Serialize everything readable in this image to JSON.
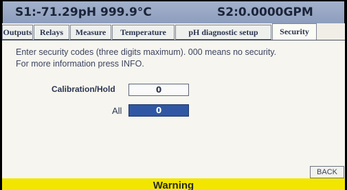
{
  "header": {
    "s1_reading": "S1:-71.29pH 999.9°C",
    "s2_reading": "S2:0.0000GPM"
  },
  "tabs": [
    {
      "label": "Outputs"
    },
    {
      "label": "Relays"
    },
    {
      "label": "Measure"
    },
    {
      "label": "Temperature"
    },
    {
      "label": "pH diagnostic setup"
    },
    {
      "label": "Security",
      "active": true
    }
  ],
  "panel": {
    "description_line1": "Enter security codes (three digits maximum). 000 means no security.",
    "description_line2": "For more information press INFO.",
    "fields": [
      {
        "label": "Calibration/Hold",
        "value": "0",
        "selected": false
      },
      {
        "label": "All",
        "value": "0",
        "selected": true
      }
    ],
    "back_label": "BACK"
  },
  "status_bar": {
    "text": "Warning",
    "color": "#f2e600"
  },
  "colors": {
    "header_bg": "#95a5c4",
    "selected_field": "#2f57a3"
  }
}
